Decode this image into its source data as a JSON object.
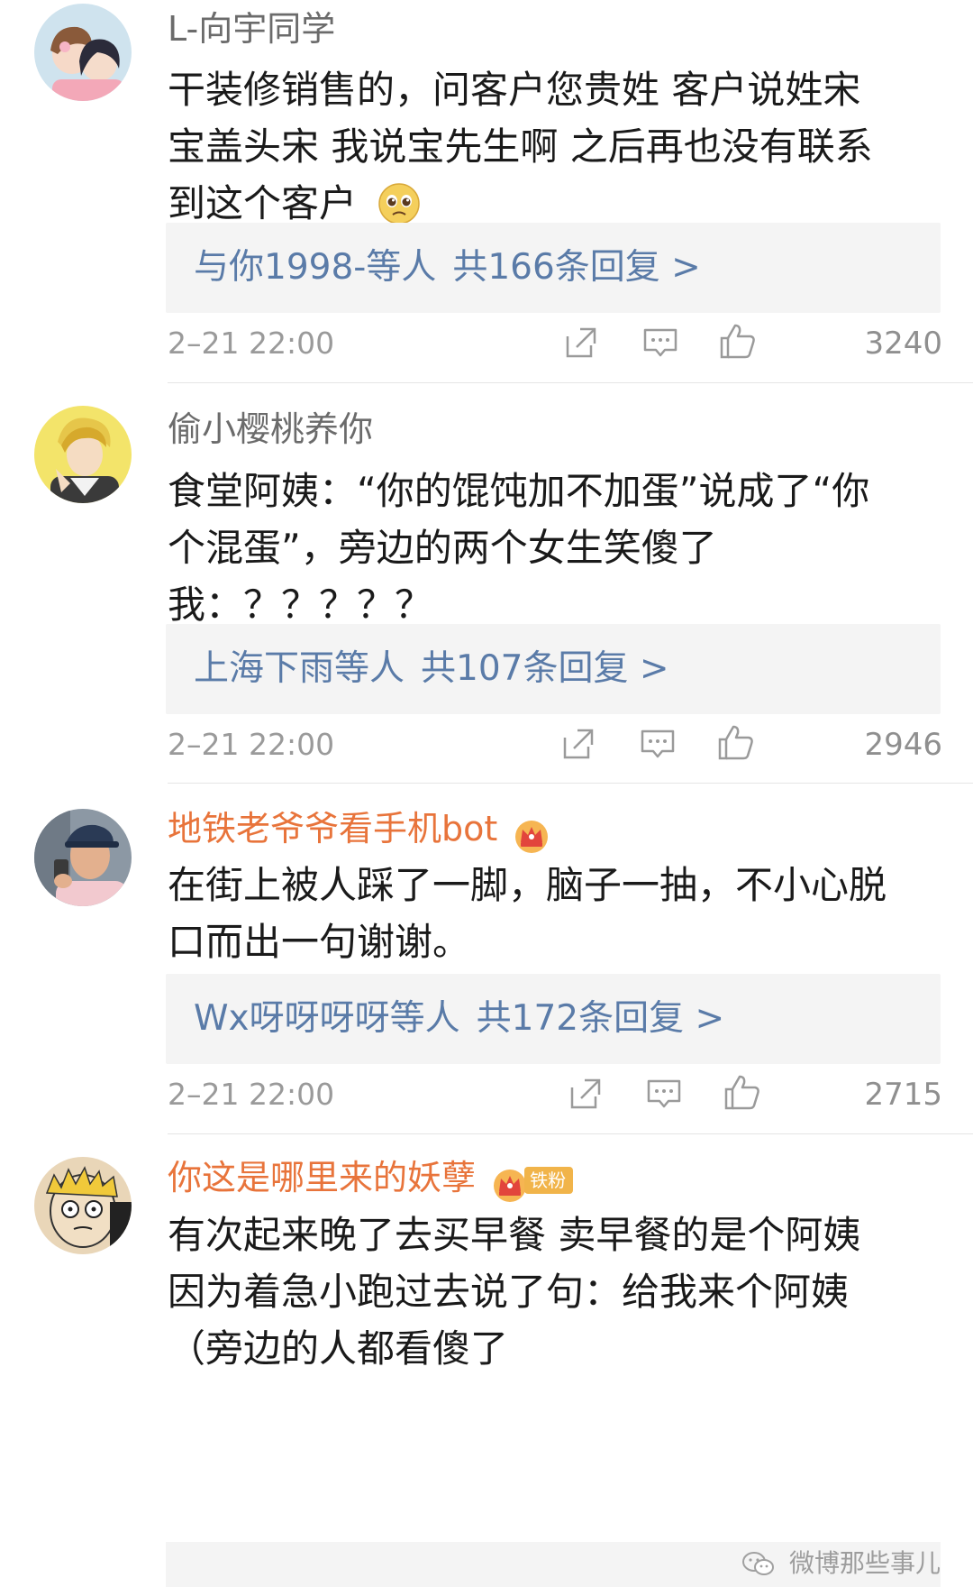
{
  "comments": [
    {
      "username": "L-向宇同学",
      "lines": [
        "干装修销售的，问客户您贵姓 客户说姓宋",
        "宝盖头宋 我说宝先生啊 之后再也没有联系",
        "到这个客户"
      ],
      "emoji": "pleading-face-emoji",
      "reply_users": "与你1998-等人",
      "reply_count": "共166条回复 >",
      "time": "2–21 22:00",
      "likes": "3240"
    },
    {
      "username": "偷小樱桃养你",
      "lines": [
        "食堂阿姨：“你的馄饨加不加蛋”说成了“你",
        "个混蛋”，旁边的两个女生笑傻了",
        "我：？？？？？"
      ],
      "reply_users": "上海下雨等人",
      "reply_count": "共107条回复 >",
      "time": "2–21 22:00",
      "likes": "2946"
    },
    {
      "username": "地铁老爷爷看手机bot",
      "lines": [
        "在街上被人踩了一脚，脑子一抽，不小心脱",
        "口而出一句谢谢。"
      ],
      "reply_users": "Wx呀呀呀呀等人",
      "reply_count": "共172条回复 >",
      "time": "2–21 22:00",
      "likes": "2715"
    },
    {
      "username": "你这是哪里来的妖孽",
      "fan_badge": "铁粉",
      "lines": [
        "有次起来晚了去买早餐 卖早餐的是个阿姨",
        "因为着急小跑过去说了句：给我来个阿姨",
        "（旁边的人都看傻了"
      ]
    }
  ],
  "watermark": "微博那些事儿",
  "colors": {
    "link": "#5a7ba8",
    "vip_name": "#e8743b",
    "reply_bg": "#f4f4f4"
  }
}
